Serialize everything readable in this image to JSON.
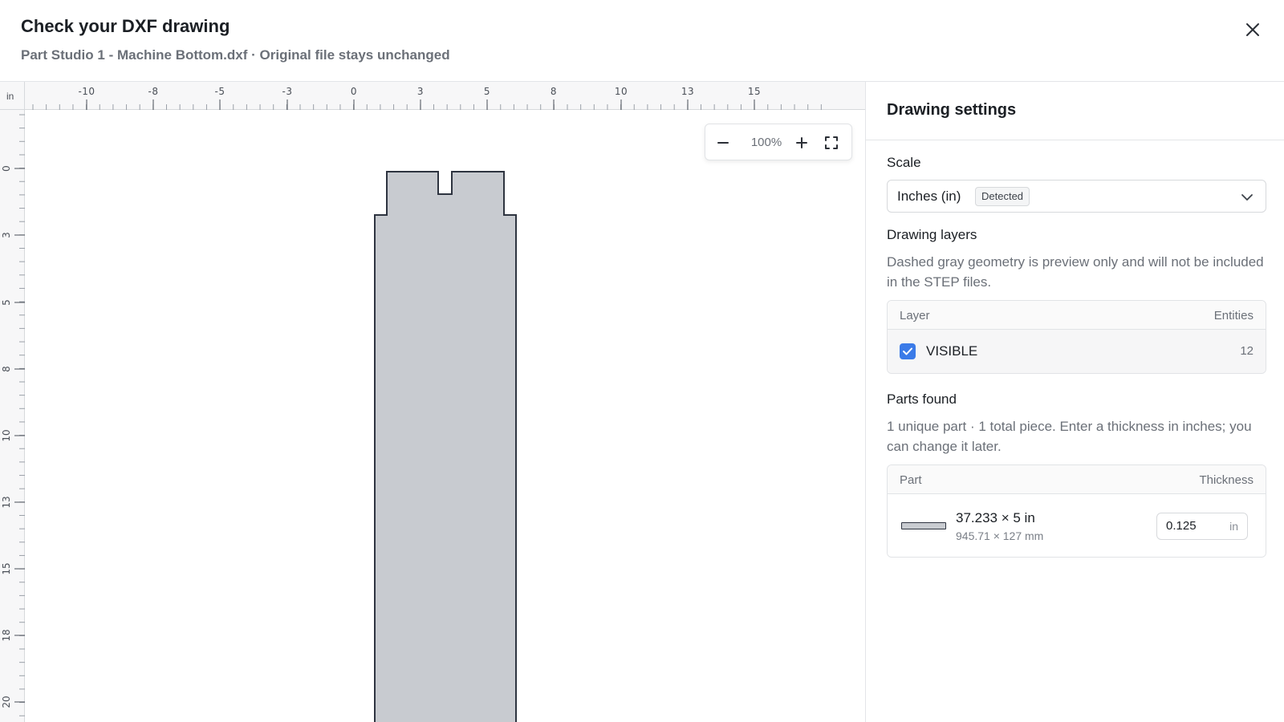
{
  "header": {
    "title": "Check your DXF drawing",
    "subtitle": "Part Studio 1 - Machine Bottom.dxf · Original file stays unchanged"
  },
  "canvas": {
    "ruler_unit": "in",
    "top_ruler_labels": [
      "-10",
      "-8",
      "-5",
      "-3",
      "0",
      "3",
      "5",
      "8",
      "10",
      "13",
      "15"
    ],
    "left_ruler_labels": [
      "0",
      "3",
      "5",
      "8",
      "10",
      "13",
      "15",
      "18",
      "20"
    ],
    "zoom_level": "100%",
    "shape_fill": "#c8cbd0",
    "shape_stroke": "#2e3440"
  },
  "panel": {
    "title": "Drawing settings",
    "scale": {
      "label": "Scale",
      "value": "Inches (in)",
      "badge": "Detected"
    },
    "layers": {
      "label": "Drawing layers",
      "description": "Dashed gray geometry is preview only and will not be included in the STEP files.",
      "col_layer": "Layer",
      "col_entities": "Entities",
      "rows": [
        {
          "name": "VISIBLE",
          "entities": "12",
          "checked": true
        }
      ]
    },
    "parts": {
      "label": "Parts found",
      "description": "1 unique part · 1 total piece. Enter a thickness in inches; you can change it later.",
      "col_part": "Part",
      "col_thickness": "Thickness",
      "rows": [
        {
          "dims_in": "37.233 × 5 in",
          "dims_mm": "945.71 × 127 mm",
          "thickness": "0.125",
          "unit": "in"
        }
      ]
    }
  },
  "colors": {
    "accent": "#3b7be8",
    "border": "#e1e3e6"
  }
}
